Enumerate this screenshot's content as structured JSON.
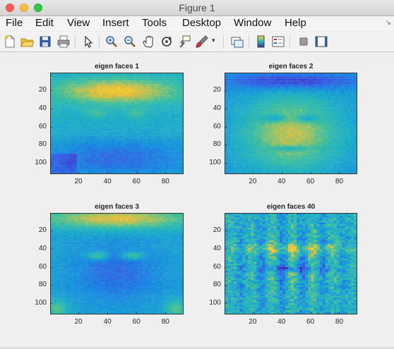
{
  "window": {
    "title": "Figure 1"
  },
  "menubar": {
    "items": [
      "File",
      "Edit",
      "View",
      "Insert",
      "Tools",
      "Desktop",
      "Window",
      "Help"
    ]
  },
  "toolbar": {
    "tools": [
      "new-figure-icon",
      "open-icon",
      "save-icon",
      "print-icon",
      "pointer-icon",
      "zoom-in-icon",
      "zoom-out-icon",
      "pan-hand-icon",
      "rotate-3d-icon",
      "data-cursor-icon",
      "brush-icon",
      "link-plot-icon",
      "colorbar-icon",
      "legend-icon",
      "hide-plot-tools-icon",
      "show-plot-tools-icon"
    ]
  },
  "colors": {
    "low": "#3e26a8",
    "mid": "#26b3c4",
    "high": "#f9e022"
  },
  "chart_data": [
    {
      "type": "heatmap",
      "title": "eigen faces 1",
      "xticks": [
        20,
        40,
        60,
        80
      ],
      "yticks": [
        20,
        40,
        60,
        80,
        100
      ],
      "xlim": [
        0.5,
        92.5
      ],
      "ylim": [
        112.5,
        0.5
      ]
    },
    {
      "type": "heatmap",
      "title": "eigen faces 2",
      "xticks": [
        20,
        40,
        60,
        80
      ],
      "yticks": [
        20,
        40,
        60,
        80,
        100
      ],
      "xlim": [
        0.5,
        92.5
      ],
      "ylim": [
        112.5,
        0.5
      ]
    },
    {
      "type": "heatmap",
      "title": "eigen faces 3",
      "xticks": [
        20,
        40,
        60,
        80
      ],
      "yticks": [
        20,
        40,
        60,
        80,
        100
      ],
      "xlim": [
        0.5,
        92.5
      ],
      "ylim": [
        112.5,
        0.5
      ]
    },
    {
      "type": "heatmap",
      "title": "eigen faces 40",
      "xticks": [
        20,
        40,
        60,
        80
      ],
      "yticks": [
        20,
        40,
        60,
        80,
        100
      ],
      "xlim": [
        0.5,
        92.5
      ],
      "ylim": [
        112.5,
        0.5
      ]
    }
  ]
}
